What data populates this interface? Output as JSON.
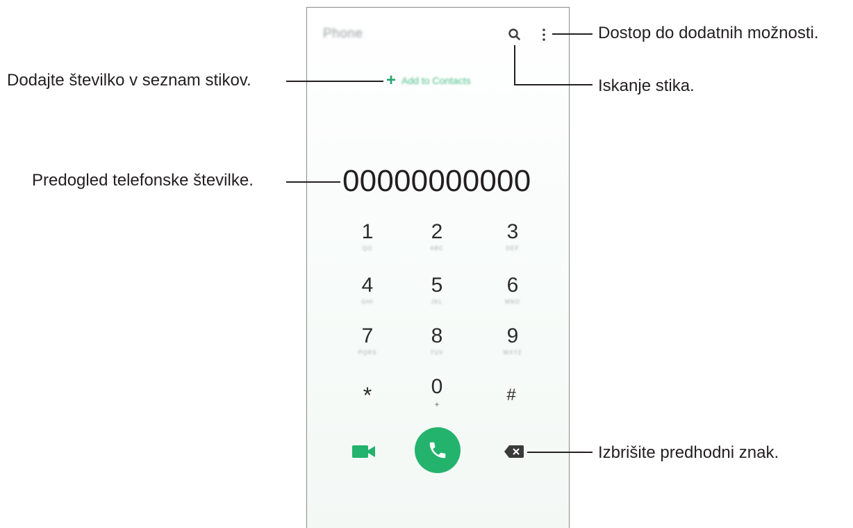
{
  "phone": {
    "app_title": "Phone",
    "add_to_contacts": "Add to Contacts",
    "number_display": "00000000000",
    "keypad": [
      {
        "digit": "1",
        "letters": "QO"
      },
      {
        "digit": "2",
        "letters": "ABC"
      },
      {
        "digit": "3",
        "letters": "DEF"
      },
      {
        "digit": "4",
        "letters": "GHI"
      },
      {
        "digit": "5",
        "letters": "JKL"
      },
      {
        "digit": "6",
        "letters": "MNO"
      },
      {
        "digit": "7",
        "letters": "PQRS"
      },
      {
        "digit": "8",
        "letters": "TUV"
      },
      {
        "digit": "9",
        "letters": "WXYZ"
      },
      {
        "digit": "*",
        "letters": ""
      },
      {
        "digit": "0",
        "letters": "+"
      },
      {
        "digit": "#",
        "letters": ""
      }
    ],
    "accent_color": "#23b36c"
  },
  "callouts": {
    "more_options": "Dostop do dodatnih možnosti.",
    "add_contact": "Dodajte številko v seznam stikov.",
    "search_contacts": "Iskanje stika.",
    "number_preview": "Predogled telefonske številke.",
    "delete_char": "Izbrišite predhodni znak."
  }
}
